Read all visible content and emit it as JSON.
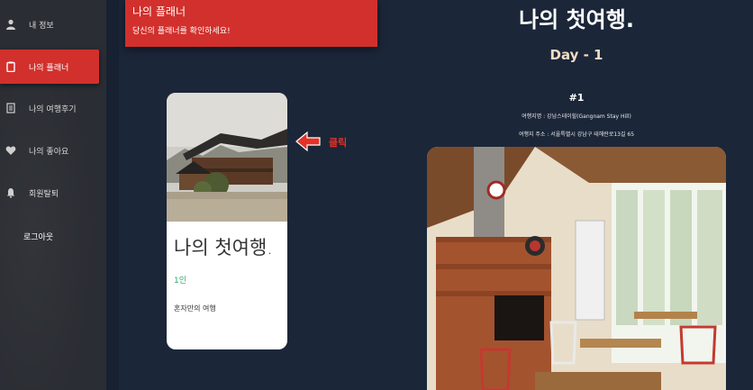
{
  "sidebar": {
    "items": [
      {
        "label": "내 정보",
        "icon": "user-icon"
      },
      {
        "label": "나의 플래너",
        "icon": "clipboard-icon",
        "active": true
      },
      {
        "label": "나의 여행후기",
        "icon": "notebook-icon"
      },
      {
        "label": "나의 좋아요",
        "icon": "heart-icon"
      },
      {
        "label": "회원탈퇴",
        "icon": "bell-icon"
      }
    ],
    "logout": "로그아웃"
  },
  "header": {
    "title": "나의 플래너",
    "subtitle": "당신의 플래너를 확인하세요!"
  },
  "plan_card": {
    "title": "나의 첫여행.",
    "people": "1인",
    "description": "혼자만의 여행"
  },
  "annotation": {
    "label": "클릭",
    "color": "#e53127"
  },
  "detail": {
    "title": "나의 첫여행.",
    "day": "Day - 1",
    "number": "#1",
    "place_name": "여행지명 : 강남스테이힐(Gangnam Stay Hill)",
    "place_address": "여행지 주소 : 서울특별시 강남구 테헤란로13길 65"
  },
  "colors": {
    "accent": "#d2302c",
    "background": "#1b2638",
    "sidebar": "#2a2d33",
    "people_green": "#2fa86b"
  }
}
